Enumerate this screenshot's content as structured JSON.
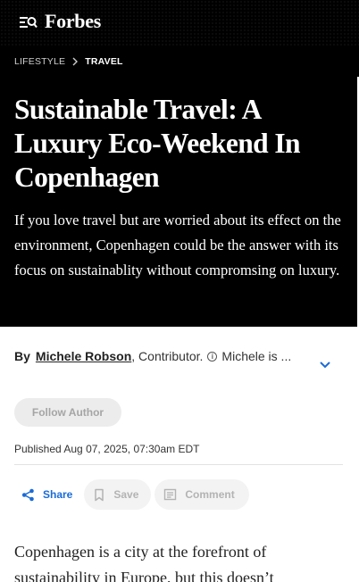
{
  "header": {
    "logo": "Forbes",
    "menu_icon": "menu-search-icon"
  },
  "breadcrumb": {
    "section": "LIFESTYLE",
    "subsection": "TRAVEL"
  },
  "article": {
    "headline": "Sustainable Travel: A Luxury Eco-Weekend In Copenhagen",
    "dek": "If you love travel but are worried about its effect on the environment, Copenhagen could be the answer with its focus on sustainablity without compromsing on luxury.",
    "byline": {
      "by": "By",
      "author": "Michele Robson",
      "role": ", Contributor.",
      "info_glyph": "i",
      "bio_preview": "Michele is ..."
    },
    "follow_label": "Follow Author",
    "published": "Published Aug 07, 2025, 07:30am EDT",
    "actions": {
      "share": "Share",
      "save": "Save",
      "comment": "Comment"
    },
    "body_start": "Copenhagen is a city at the forefront of sustainability in Europe, but this doesn’t"
  },
  "colors": {
    "header_bg": "#000000",
    "share_blue": "#1a6bd8",
    "disabled_text": "#b3b3b3"
  }
}
